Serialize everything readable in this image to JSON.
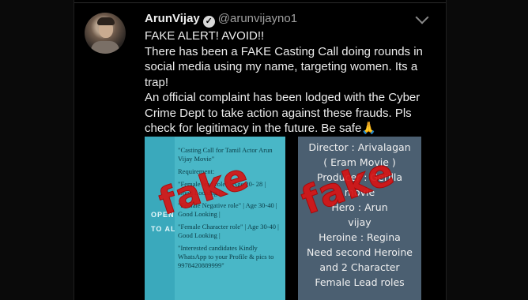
{
  "tweet": {
    "author_name": "ArunVijay",
    "verified_badge": "verified-badge-icon",
    "handle": "@arunvijayno1",
    "menu": "chevron-down-icon",
    "lines": [
      "FAKE ALERT! AVOID!!",
      "There has been a FAKE Casting Call doing rounds in social media using my name, targeting women. Its a trap!",
      "An official complaint has been lodged with the Cyber Crime Dept to take action against these frauds. Pls check for legitimacy in the future. Be safe🙏"
    ]
  },
  "image_left": {
    "open_label_1": "OPEN",
    "open_label_2": "TO AL",
    "doc_lines": [
      "\"Casting Call for Tamil Actor Arun Vijay Movie\"",
      "Requirement:",
      "\"Female lead role\" | Age 20- 28 | Good Looking |",
      "\"Female Negative role\" | Age 30-40 | Good Looking |",
      "\"Female Character role\" | Age 30-40 | Good Looking |",
      "\"Interested candidates Kindly WhatsApp to your Profile & pics to 9978420889999\""
    ],
    "stamp": "fake"
  },
  "image_right": {
    "lines": [
      "Director : Arivalagan",
      "( Eram Movie )",
      "Producer : Gerilla",
      "movie",
      "Hero :   Arun",
      "vijay",
      "Heroine :   Regina",
      "Need second Heroine",
      "and 2 Character",
      "Female Lead roles"
    ],
    "stamp": "fake"
  }
}
